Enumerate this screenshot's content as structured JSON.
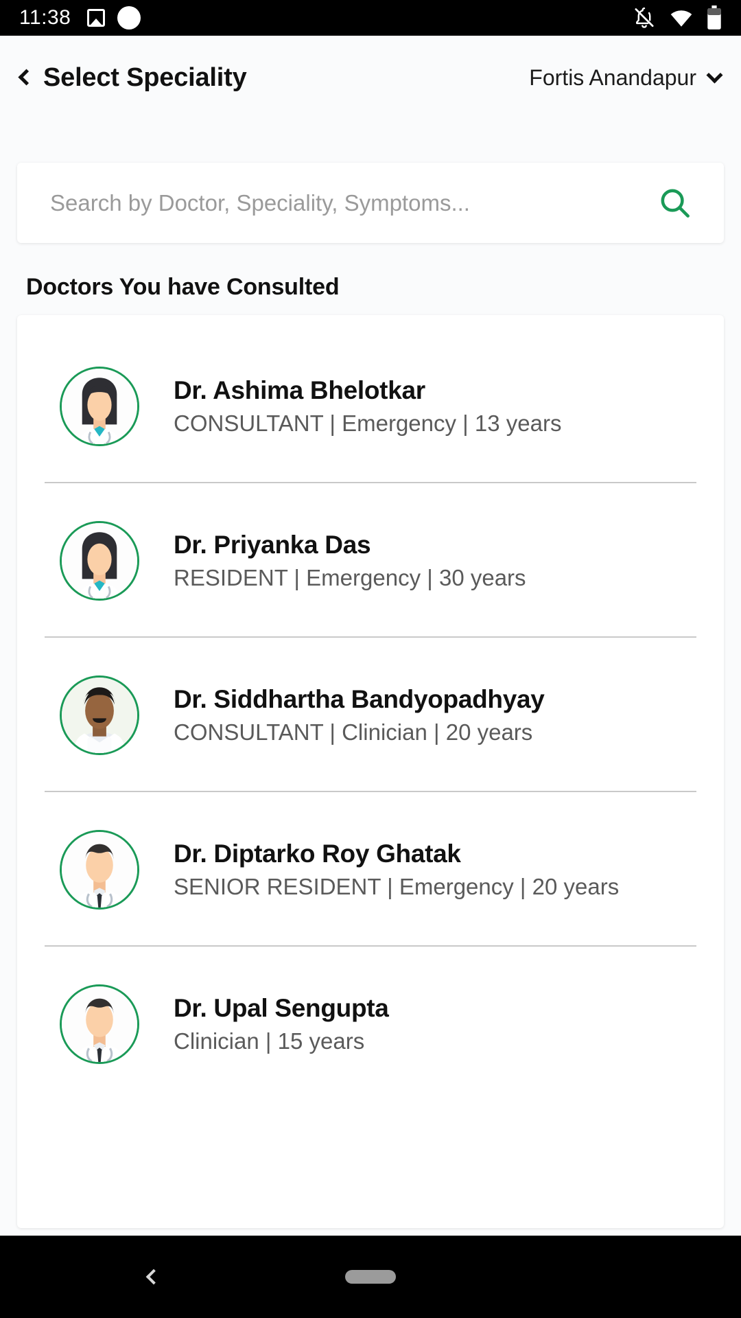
{
  "status_bar": {
    "time": "11:38",
    "left_icons": [
      "photo-icon",
      "circle-icon"
    ],
    "right_icons": [
      "notifications-off-icon",
      "wifi-icon",
      "battery-icon"
    ]
  },
  "header": {
    "back_icon": "chevron-left-icon",
    "title": "Select Speciality",
    "site_name": "Fortis Anandapur",
    "site_dropdown_icon": "chevron-down-icon"
  },
  "search": {
    "placeholder": "Search by Doctor, Speciality, Symptoms...",
    "value": "",
    "icon": "search-icon",
    "icon_color": "#1a9a57"
  },
  "section": {
    "title": "Doctors You have Consulted"
  },
  "doctors": [
    {
      "name": "Dr. Ashima Bhelotkar",
      "meta": "CONSULTANT | Emergency | 13 years",
      "avatar": "female-doctor-avatar"
    },
    {
      "name": "Dr. Priyanka Das",
      "meta": "RESIDENT | Emergency | 30 years",
      "avatar": "female-doctor-avatar"
    },
    {
      "name": "Dr. Siddhartha Bandyopadhyay",
      "meta": "CONSULTANT | Clinician | 20 years",
      "avatar": "male-doctor-photo"
    },
    {
      "name": "Dr. Diptarko Roy Ghatak",
      "meta": "SENIOR RESIDENT | Emergency | 20 years",
      "avatar": "male-doctor-avatar"
    },
    {
      "name": "Dr. Upal Sengupta",
      "meta": "Clinician | 15 years",
      "avatar": "male-doctor-avatar"
    }
  ],
  "nav_bar": {
    "back_icon": "nav-back-icon",
    "home_pill": "nav-home-pill"
  },
  "colors": {
    "accent_green": "#1a9a57",
    "page_background": "#fafbfc",
    "card_background": "#ffffff",
    "primary_text": "#111111",
    "secondary_text": "#5a5a5a",
    "placeholder_text": "#9a9a9a"
  }
}
